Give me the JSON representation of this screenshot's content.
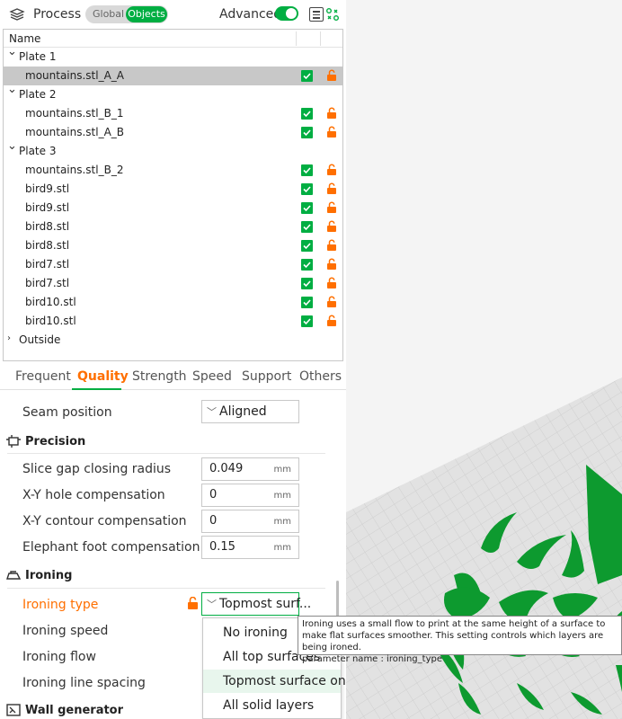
{
  "header": {
    "title": "Process",
    "mode_global": "Global",
    "mode_objects": "Objects",
    "advanced_label": "Advanced",
    "advanced_on": true
  },
  "tree": {
    "column_name": "Name",
    "rows": [
      {
        "type": "plate",
        "label": "Plate 1",
        "expanded": true
      },
      {
        "type": "object",
        "label": "mountains.stl_A_A",
        "selected": true
      },
      {
        "type": "plate",
        "label": "Plate 2",
        "expanded": true
      },
      {
        "type": "object",
        "label": "mountains.stl_B_1"
      },
      {
        "type": "object",
        "label": "mountains.stl_A_B"
      },
      {
        "type": "plate",
        "label": "Plate 3",
        "expanded": true
      },
      {
        "type": "object",
        "label": "mountains.stl_B_2"
      },
      {
        "type": "object",
        "label": "bird9.stl"
      },
      {
        "type": "object",
        "label": "bird9.stl"
      },
      {
        "type": "object",
        "label": "bird8.stl"
      },
      {
        "type": "object",
        "label": "bird8.stl"
      },
      {
        "type": "object",
        "label": "bird7.stl"
      },
      {
        "type": "object",
        "label": "bird7.stl"
      },
      {
        "type": "object",
        "label": "bird10.stl"
      },
      {
        "type": "object",
        "label": "bird10.stl"
      },
      {
        "type": "plate",
        "label": "Outside",
        "expanded": false
      }
    ]
  },
  "tabs": [
    "Frequent",
    "Quality",
    "Strength",
    "Speed",
    "Support",
    "Others"
  ],
  "active_tab": "Quality",
  "settings": {
    "seam_position_label": "Seam position",
    "seam_position_value": "Aligned",
    "precision_title": "Precision",
    "slice_gap_label": "Slice gap closing radius",
    "slice_gap_value": "0.049",
    "xy_hole_label": "X-Y hole compensation",
    "xy_hole_value": "0",
    "xy_contour_label": "X-Y contour compensation",
    "xy_contour_value": "0",
    "elephant_label": "Elephant foot compensation",
    "elephant_value": "0.15",
    "unit": "mm",
    "ironing_title": "Ironing",
    "ironing_type_label": "Ironing type",
    "ironing_type_value": "Topmost surf...",
    "ironing_speed_label": "Ironing speed",
    "ironing_flow_label": "Ironing flow",
    "ironing_spacing_label": "Ironing line spacing",
    "wall_generator_title": "Wall generator"
  },
  "dropdown": {
    "options": [
      "No ironing",
      "All top surfaces",
      "Topmost surface only",
      "All solid layers"
    ],
    "highlighted": "Topmost surface only"
  },
  "tooltip": {
    "text": "Ironing uses a small flow to print at the same height of a surface to make flat surfaces smoother. This setting controls which layers are being ironed.",
    "param": "parameter name    : ironing_type"
  },
  "colors": {
    "accent_green": "#00ae42",
    "accent_orange": "#ff6f00"
  }
}
